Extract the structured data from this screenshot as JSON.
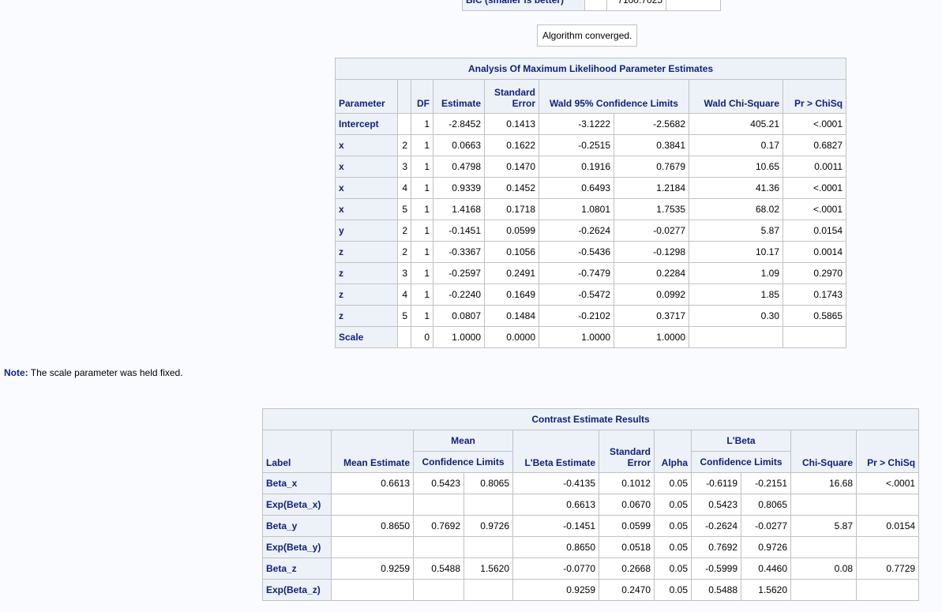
{
  "fit_stats_partial": {
    "label": "BIC (smaller is better)",
    "value": "7100.7025"
  },
  "convergence": "Algorithm converged.",
  "pe": {
    "title": "Analysis Of Maximum Likelihood Parameter Estimates",
    "headers": {
      "parameter": "Parameter",
      "df": "DF",
      "estimate": "Estimate",
      "se1": "Standard",
      "se2": "Error",
      "wald": "Wald 95% Confidence Limits",
      "chisq": "Wald Chi-Square",
      "pr": "Pr > ChiSq"
    },
    "rows": [
      [
        "Intercept",
        "",
        "1",
        "-2.8452",
        "0.1413",
        "-3.1222",
        "-2.5682",
        "405.21",
        "<.0001"
      ],
      [
        "x",
        "2",
        "1",
        "0.0663",
        "0.1622",
        "-0.2515",
        "0.3841",
        "0.17",
        "0.6827"
      ],
      [
        "x",
        "3",
        "1",
        "0.4798",
        "0.1470",
        "0.1916",
        "0.7679",
        "10.65",
        "0.0011"
      ],
      [
        "x",
        "4",
        "1",
        "0.9339",
        "0.1452",
        "0.6493",
        "1.2184",
        "41.36",
        "<.0001"
      ],
      [
        "x",
        "5",
        "1",
        "1.4168",
        "0.1718",
        "1.0801",
        "1.7535",
        "68.02",
        "<.0001"
      ],
      [
        "y",
        "2",
        "1",
        "-0.1451",
        "0.0599",
        "-0.2624",
        "-0.0277",
        "5.87",
        "0.0154"
      ],
      [
        "z",
        "2",
        "1",
        "-0.3367",
        "0.1056",
        "-0.5436",
        "-0.1298",
        "10.17",
        "0.0014"
      ],
      [
        "z",
        "3",
        "1",
        "-0.2597",
        "0.2491",
        "-0.7479",
        "0.2284",
        "1.09",
        "0.2970"
      ],
      [
        "z",
        "4",
        "1",
        "-0.2240",
        "0.1649",
        "-0.5472",
        "0.0992",
        "1.85",
        "0.1743"
      ],
      [
        "z",
        "5",
        "1",
        "0.0807",
        "0.1484",
        "-0.2102",
        "0.3717",
        "0.30",
        "0.5865"
      ],
      [
        "Scale",
        "",
        "0",
        "1.0000",
        "0.0000",
        "1.0000",
        "1.0000",
        "",
        ""
      ]
    ]
  },
  "note": {
    "label": "Note:",
    "text": " The scale parameter was held fixed."
  },
  "ce": {
    "title": "Contrast Estimate Results",
    "headers": {
      "label": "Label",
      "mean_est": "Mean Estimate",
      "mean": "Mean",
      "mean_cl": "Confidence Limits",
      "lbeta_est": "L'Beta Estimate",
      "se1": "Standard",
      "se2": "Error",
      "alpha": "Alpha",
      "lbeta": "L'Beta",
      "lbeta_cl": "Confidence Limits",
      "chisq": "Chi-Square",
      "pr": "Pr > ChiSq"
    },
    "rows": [
      [
        "Beta_x",
        "0.6613",
        "0.5423",
        "0.8065",
        "-0.4135",
        "0.1012",
        "0.05",
        "-0.6119",
        "-0.2151",
        "16.68",
        "<.0001"
      ],
      [
        "Exp(Beta_x)",
        "",
        "",
        "",
        "0.6613",
        "0.0670",
        "0.05",
        "0.5423",
        "0.8065",
        "",
        ""
      ],
      [
        "Beta_y",
        "0.8650",
        "0.7692",
        "0.9726",
        "-0.1451",
        "0.0599",
        "0.05",
        "-0.2624",
        "-0.0277",
        "5.87",
        "0.0154"
      ],
      [
        "Exp(Beta_y)",
        "",
        "",
        "",
        "0.8650",
        "0.0518",
        "0.05",
        "0.7692",
        "0.9726",
        "",
        ""
      ],
      [
        "Beta_z",
        "0.9259",
        "0.5488",
        "1.5620",
        "-0.0770",
        "0.2668",
        "0.05",
        "-0.5999",
        "0.4460",
        "0.08",
        "0.7729"
      ],
      [
        "Exp(Beta_z)",
        "",
        "",
        "",
        "0.9259",
        "0.2470",
        "0.05",
        "0.5488",
        "1.5620",
        "",
        ""
      ]
    ]
  }
}
